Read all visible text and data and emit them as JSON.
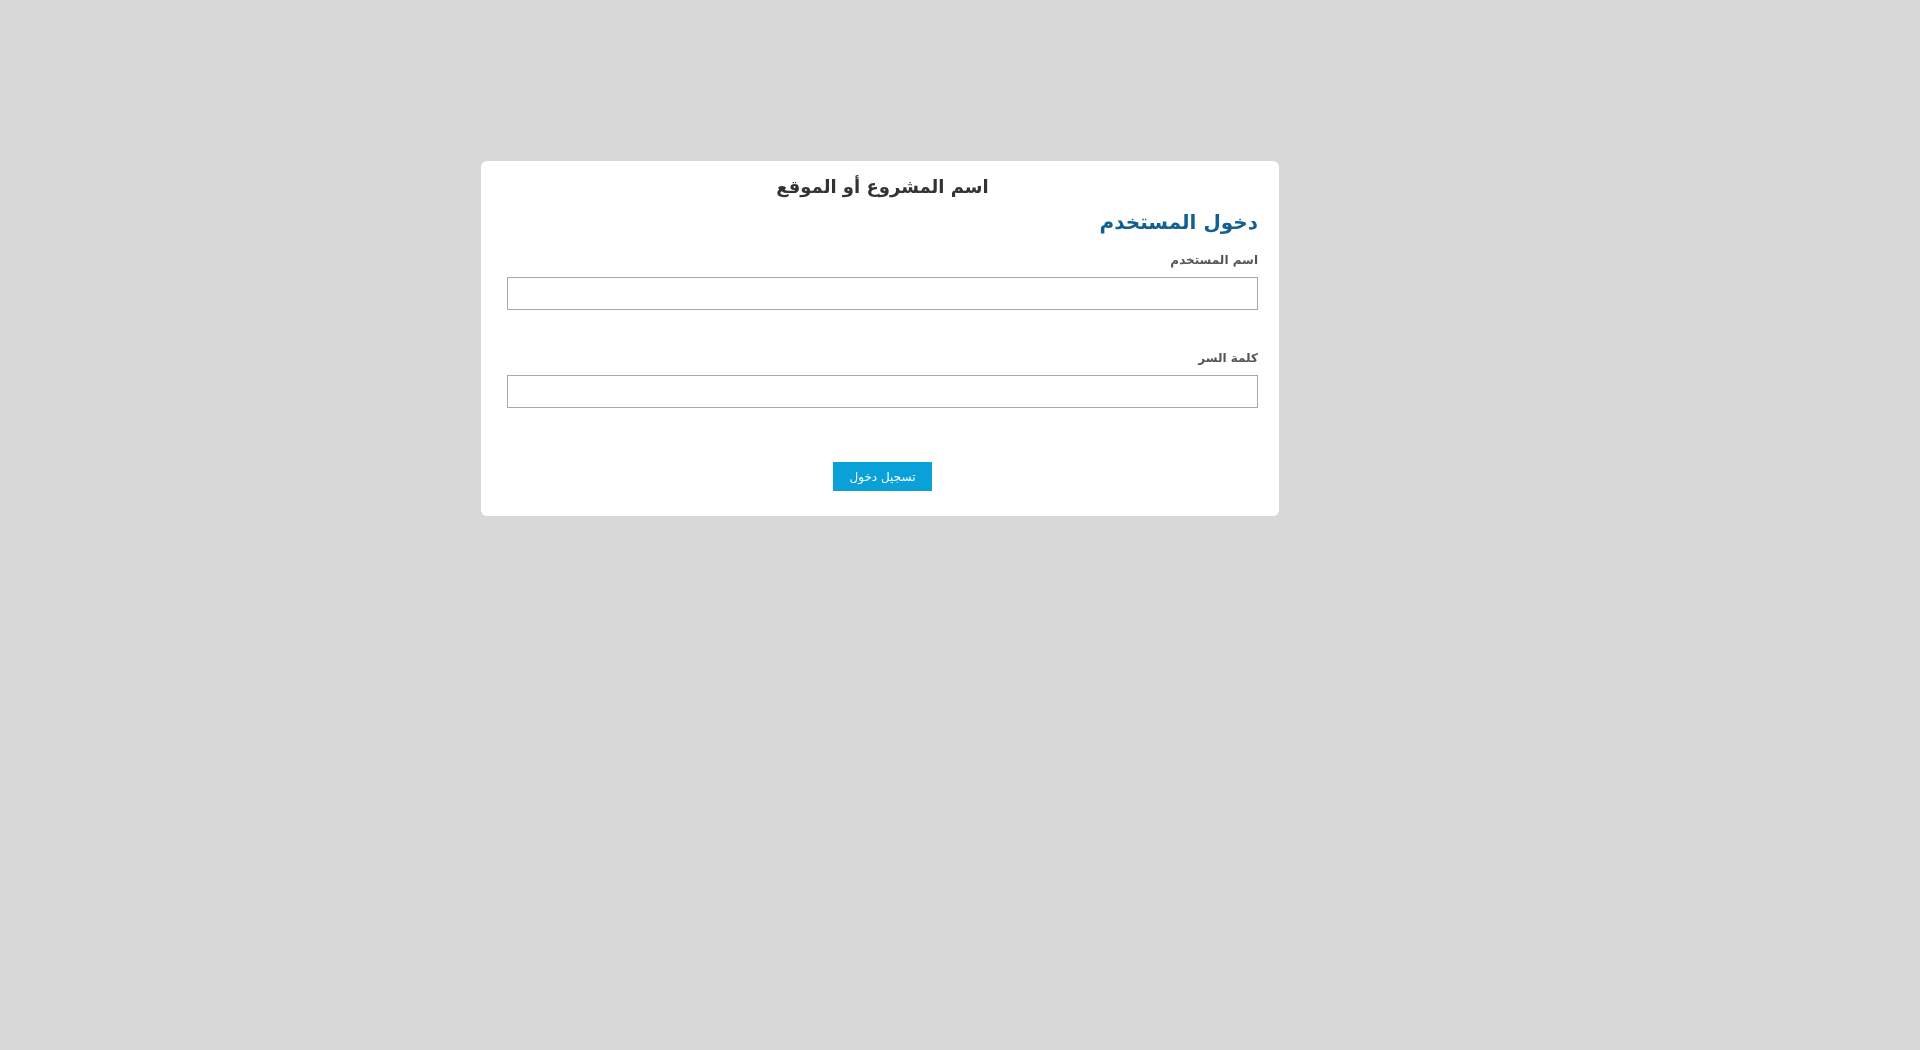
{
  "page": {
    "title": "اسم المشروع أو الموقع"
  },
  "login_form": {
    "heading": "دخول المستخدم",
    "fields": [
      {
        "label": "اسم المستخدم"
      },
      {
        "label": "كلمة السر"
      }
    ],
    "submit_button": "تسجيل دخول"
  }
}
